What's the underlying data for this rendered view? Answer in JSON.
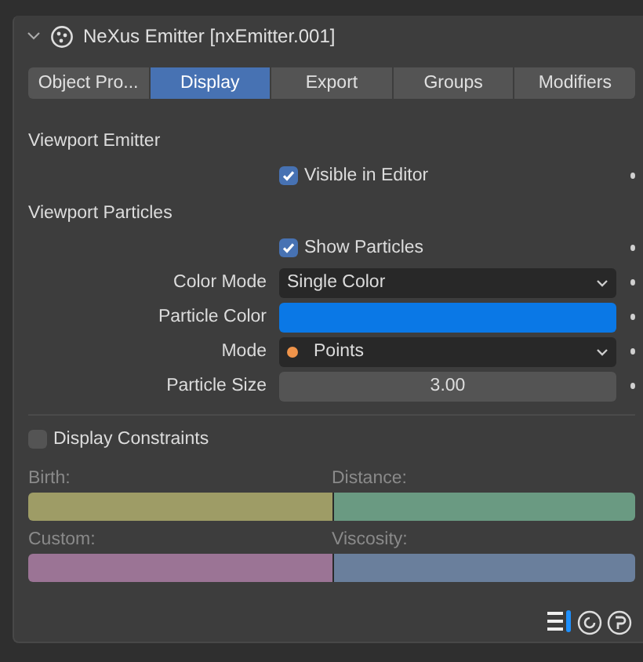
{
  "panel": {
    "title": "NeXus Emitter [nxEmitter.001]",
    "expanded": true
  },
  "tabs": [
    {
      "label": "Object Pro...",
      "selected": false
    },
    {
      "label": "Display",
      "selected": true
    },
    {
      "label": "Export",
      "selected": false
    },
    {
      "label": "Groups",
      "selected": false
    },
    {
      "label": "Modifiers",
      "selected": false
    }
  ],
  "sections": [
    {
      "title": "Viewport Emitter",
      "rows": [
        {
          "kind": "checkbox",
          "label": "Visible in Editor",
          "checked": true
        }
      ]
    },
    {
      "title": "Viewport Particles",
      "rows": [
        {
          "kind": "checkbox",
          "label": "Show Particles",
          "checked": true
        },
        {
          "kind": "dropdown",
          "label": "Color Mode",
          "value": "Single Color"
        },
        {
          "kind": "color",
          "label": "Particle Color",
          "color": "#0a78e6"
        },
        {
          "kind": "dropdown",
          "label": "Mode",
          "value": "Points",
          "icon": true
        },
        {
          "kind": "number",
          "label": "Particle Size",
          "value": "3.00"
        }
      ]
    }
  ],
  "constraints": {
    "label": "Display Constraints",
    "checked": false,
    "items": [
      {
        "label": "Birth:",
        "color": "#9e9c66"
      },
      {
        "label": "Distance:",
        "color": "#6a9a82"
      },
      {
        "label": "Custom:",
        "color": "#9b7495"
      },
      {
        "label": "Viscosity:",
        "color": "#6a7f9c"
      }
    ]
  }
}
